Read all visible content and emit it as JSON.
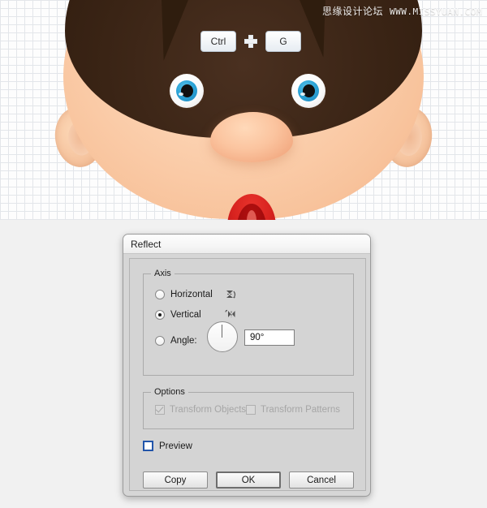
{
  "canvas": {
    "watermark_cn": "思缘设计论坛",
    "watermark_url": "WWW.MISSYUAN.COM",
    "shortcut": {
      "key1": "Ctrl",
      "plus_icon": "plus-icon",
      "key2": "G"
    },
    "illustration": {
      "subject": "cartoon-boy-face",
      "colors": {
        "skin": "#fbcfa9",
        "hair": "#33200f",
        "eye_iris": "#2da5d8",
        "eye_pupil": "#101010",
        "mouth": "#d8231f",
        "nose": "#f3ab83"
      }
    },
    "grid_color": "#e3e6ea"
  },
  "dialog": {
    "title": "Reflect",
    "axis": {
      "legend": "Axis",
      "options": [
        {
          "label": "Horizontal",
          "selected": false,
          "icon": "reflect-horizontal-icon"
        },
        {
          "label": "Vertical",
          "selected": true,
          "icon": "reflect-vertical-icon"
        },
        {
          "label": "Angle:",
          "selected": false,
          "icon": "angle-dial-icon"
        }
      ],
      "angle_value": "90°"
    },
    "options": {
      "legend": "Options",
      "items": [
        {
          "label": "Transform Objects",
          "checked": true,
          "disabled": true
        },
        {
          "label": "Transform Patterns",
          "checked": false,
          "disabled": true
        }
      ]
    },
    "preview": {
      "label": "Preview",
      "checked": false
    },
    "buttons": [
      {
        "label": "Copy",
        "default": false
      },
      {
        "label": "OK",
        "default": true
      },
      {
        "label": "Cancel",
        "default": false
      }
    ]
  }
}
